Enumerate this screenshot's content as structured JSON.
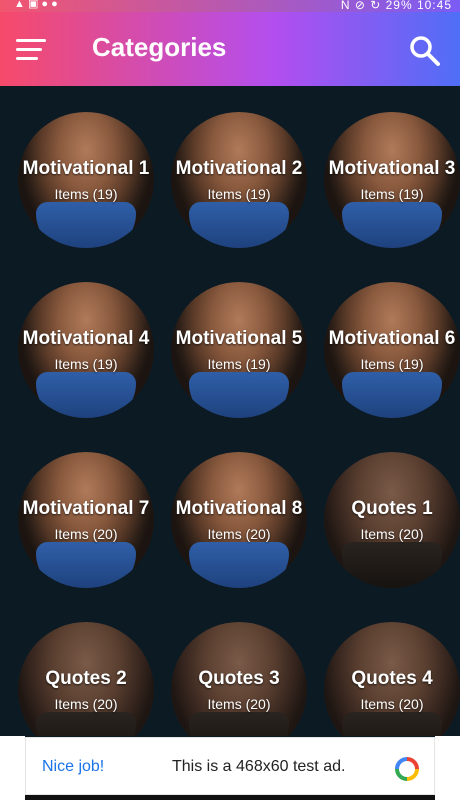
{
  "statusbar": {
    "left": "▲ ▣ ● ●",
    "right": "N ⊘ ↻ 29% 10:45"
  },
  "appbar": {
    "title": "Categories"
  },
  "categories": [
    {
      "name": "Motivational 1",
      "count": "Items (19)"
    },
    {
      "name": "Motivational 2",
      "count": "Items (19)"
    },
    {
      "name": "Motivational 3",
      "count": "Items (19)"
    },
    {
      "name": "Motivational 4",
      "count": "Items (19)"
    },
    {
      "name": "Motivational 5",
      "count": "Items (19)"
    },
    {
      "name": "Motivational 6",
      "count": "Items (19)"
    },
    {
      "name": "Motivational 7",
      "count": "Items (20)"
    },
    {
      "name": "Motivational 8",
      "count": "Items (20)"
    },
    {
      "name": "Quotes 1",
      "count": "Items (20)"
    },
    {
      "name": "Quotes 2",
      "count": "Items (20)"
    },
    {
      "name": "Quotes 3",
      "count": "Items (20)"
    },
    {
      "name": "Quotes 4",
      "count": "Items (20)"
    }
  ],
  "ad": {
    "left_text": "Nice job!",
    "text": "This is a 468x60 test ad."
  },
  "colors": {
    "appbar_start": "#f64a6a",
    "appbar_end": "#4f6ef6",
    "background": "#0c1a24",
    "ad_link": "#1a73e8"
  }
}
